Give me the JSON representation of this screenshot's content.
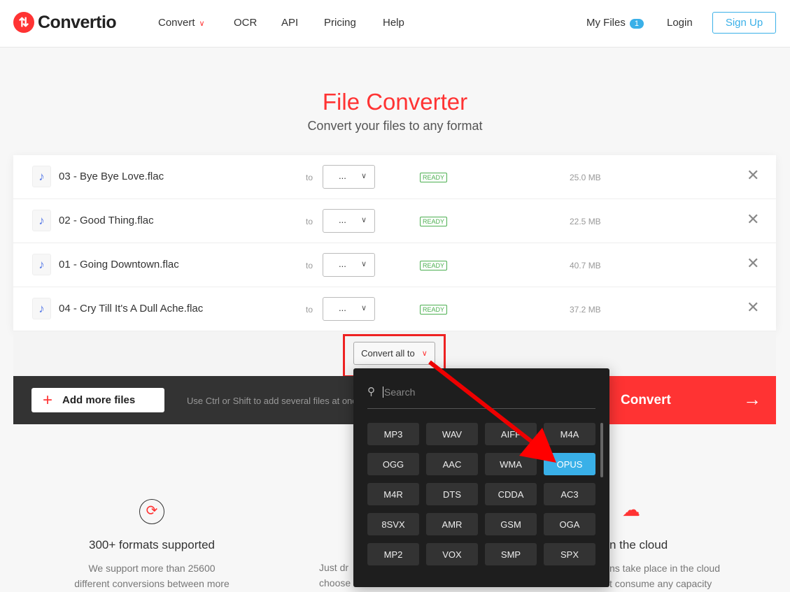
{
  "header": {
    "brand": "Convertio",
    "nav": [
      "Convert",
      "OCR",
      "API",
      "Pricing",
      "Help"
    ],
    "my_files": "My Files",
    "my_files_count": "1",
    "login": "Login",
    "signup": "Sign Up"
  },
  "hero": {
    "title": "File Converter",
    "subtitle": "Convert your files to any format"
  },
  "files": [
    {
      "name": "03 - Bye Bye Love.flac",
      "to": "to",
      "format": "...",
      "status": "READY",
      "size": "25.0 MB"
    },
    {
      "name": "02 - Good Thing.flac",
      "to": "to",
      "format": "...",
      "status": "READY",
      "size": "22.5 MB"
    },
    {
      "name": "01 - Going Downtown.flac",
      "to": "to",
      "format": "...",
      "status": "READY",
      "size": "40.7 MB"
    },
    {
      "name": "04 - Cry Till It's A Dull Ache.flac",
      "to": "to",
      "format": "...",
      "status": "READY",
      "size": "37.2 MB"
    }
  ],
  "convert_all": "Convert all to",
  "actions": {
    "add_more": "Add more files",
    "hint": "Use Ctrl or Shift to add several files at once",
    "convert": "Convert"
  },
  "popup": {
    "search_placeholder": "Search",
    "formats": [
      "MP3",
      "WAV",
      "AIFF",
      "M4A",
      "OGG",
      "AAC",
      "WMA",
      "OPUS",
      "M4R",
      "DTS",
      "CDDA",
      "AC3",
      "8SVX",
      "AMR",
      "GSM",
      "OGA",
      "MP2",
      "VOX",
      "SMP",
      "SPX"
    ],
    "selected": "OPUS"
  },
  "features": [
    {
      "title": "300+ formats supported",
      "lines": [
        "We support more than 25600",
        "different conversions between more"
      ]
    },
    {
      "lines": [
        "Just dr",
        "choose"
      ]
    },
    {
      "title": "n the cloud",
      "lines": [
        "ns take place in the cloud",
        "t consume any capacity"
      ]
    }
  ],
  "colors": {
    "accent": "#ff3333",
    "selected": "#39b0e8",
    "ready": "#4caf50"
  }
}
